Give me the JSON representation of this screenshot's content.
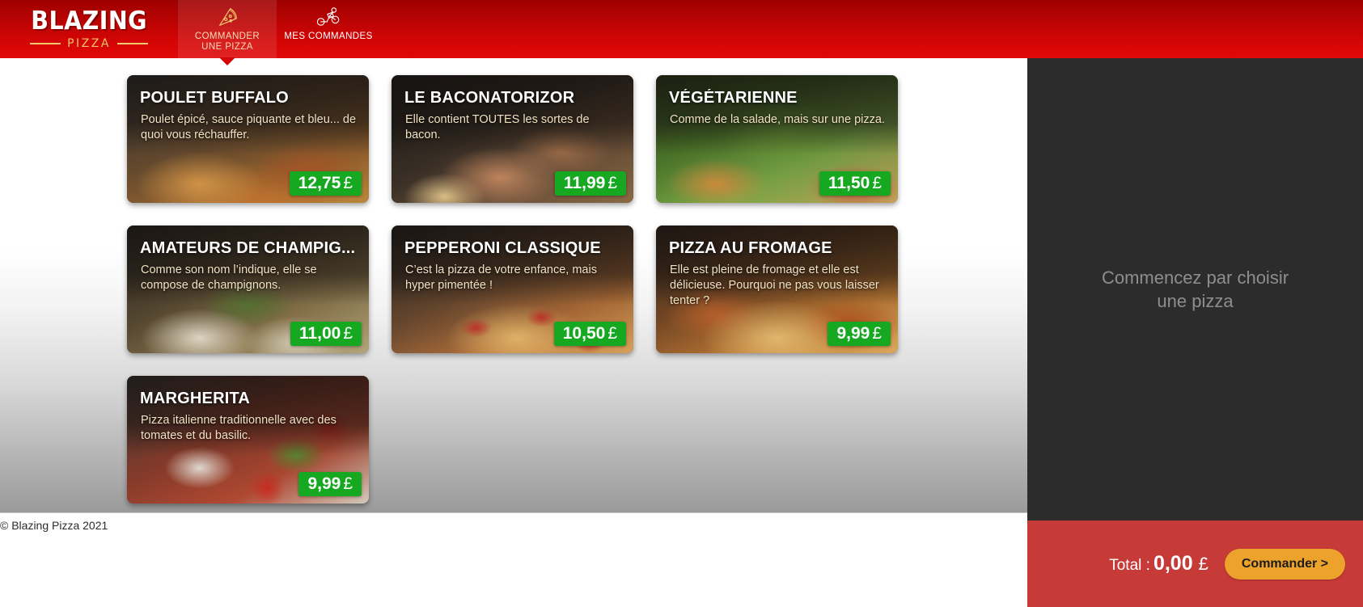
{
  "brand": {
    "name": "BLAZING",
    "tagline": "PIZZA"
  },
  "nav": {
    "tabs": [
      {
        "id": "order-pizza",
        "label_line1": "COMMANDER",
        "label_line2": "UNE PIZZA",
        "icon": "pizza-slice-icon",
        "active": true
      },
      {
        "id": "my-orders",
        "label_line1": "MES COMMANDES",
        "label_line2": "",
        "icon": "scooter-delivery-icon",
        "active": false
      }
    ]
  },
  "menu": {
    "pizzas": [
      {
        "name": "POULET BUFFALO",
        "description": "Poulet épicé, sauce piquante et bleu... de quoi vous réchauffer.",
        "price": "12,75",
        "currency": "£"
      },
      {
        "name": "LE BACONATORIZOR",
        "description": "Elle contient TOUTES les sortes de bacon.",
        "price": "11,99",
        "currency": "£"
      },
      {
        "name": "VÉGÉTARIENNE",
        "description": "Comme de la salade, mais sur une pizza.",
        "price": "11,50",
        "currency": "£"
      },
      {
        "name": "AMATEURS DE CHAMPIG...",
        "description": "Comme son nom l’indique, elle se compose de champignons.",
        "price": "11,00",
        "currency": "£"
      },
      {
        "name": "PEPPERONI CLASSIQUE",
        "description": "C’est la pizza de votre enfance, mais hyper pimentée !",
        "price": "10,50",
        "currency": "£"
      },
      {
        "name": "PIZZA AU FROMAGE",
        "description": "Elle est pleine de fromage et elle est délicieuse. Pourquoi ne pas vous laisser tenter ?",
        "price": "9,99",
        "currency": "£"
      },
      {
        "name": "MARGHERITA",
        "description": "Pizza italienne traditionnelle avec des tomates et du basilic.",
        "price": "9,99",
        "currency": "£"
      }
    ]
  },
  "sidebar": {
    "empty_message": "Commencez par choisir une pizza"
  },
  "order_bar": {
    "total_label": "Total :",
    "total_value": "0,00",
    "currency": "£",
    "order_button": "Commander >"
  },
  "footer": {
    "copyright": "© Blazing Pizza 2021"
  },
  "colors": {
    "header_red": "#d30505",
    "price_green": "#15a820",
    "order_bar_red": "#c63a38",
    "order_button_orange": "#eda22c",
    "sidebar_dark": "#2c2c2c",
    "logo_gold": "#f0c76a"
  }
}
